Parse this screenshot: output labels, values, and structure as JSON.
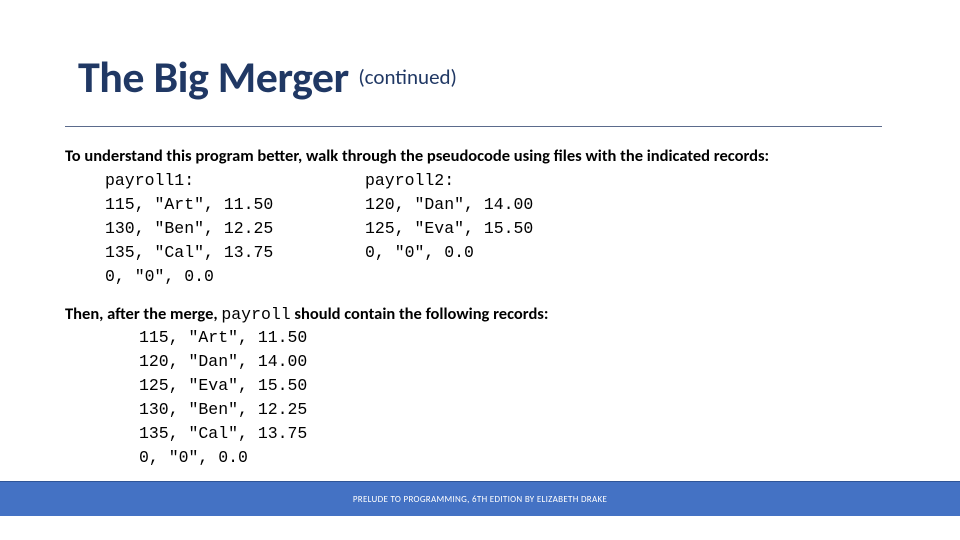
{
  "title": "The Big Merger",
  "subtitle": "(continued)",
  "intro": "To understand this program better, walk through the pseudocode using files with the indicated records:",
  "payroll1": {
    "name": "payroll1:",
    "rows": [
      "115, \"Art\", 11.50",
      "130, \"Ben\", 12.25",
      "135, \"Cal\", 13.75",
      "0, \"0\", 0.0"
    ]
  },
  "payroll2": {
    "name": "payroll2:",
    "rows": [
      "120, \"Dan\", 14.00",
      "125, \"Eva\", 15.50",
      "0, \"0\", 0.0"
    ]
  },
  "then_pre": "Then, after the merge, ",
  "then_name": "payroll",
  "then_post": " should contain the following records:",
  "merged": [
    "115, \"Art\", 11.50",
    "120, \"Dan\", 14.00",
    "125, \"Eva\", 15.50",
    "130, \"Ben\", 12.25",
    "135, \"Cal\", 13.75",
    "0, \"0\", 0.0"
  ],
  "footer": "PRELUDE TO PROGRAMMING, 6TH EDITION BY ELIZABETH DRAKE"
}
